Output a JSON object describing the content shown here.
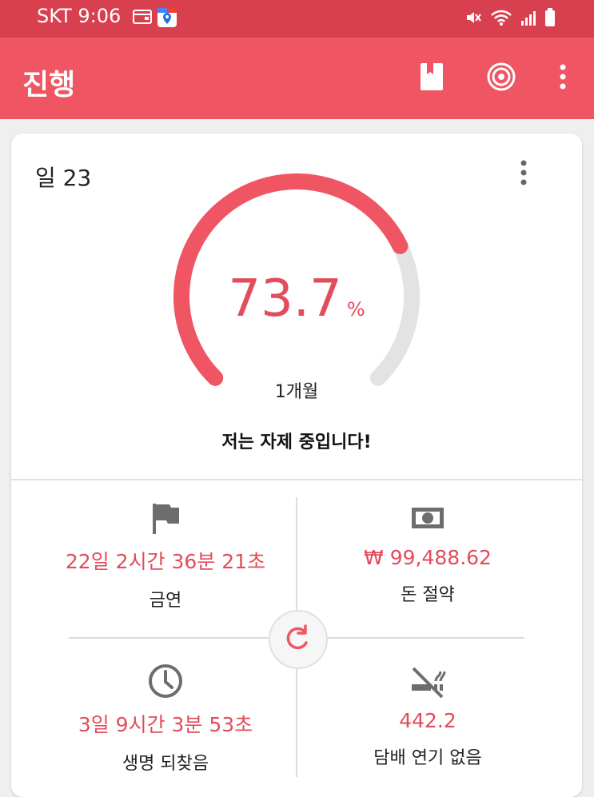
{
  "status_bar": {
    "carrier_time": "SKT 9:06",
    "icons_left": [
      "wallet-icon",
      "maps-app-icon"
    ],
    "icons_right": [
      "mute-icon",
      "wifi-icon",
      "signal-icon",
      "battery-icon"
    ]
  },
  "appbar": {
    "title": "진행",
    "actions": [
      "bookmark-icon",
      "target-icon",
      "more-vert-icon"
    ],
    "color": "#ef5563"
  },
  "progress_card": {
    "day_label": "일 23",
    "percent_value": "73.7",
    "percent_symbol": "%",
    "percent_fraction": 0.737,
    "period_label": "1개월",
    "message": "저는 자제 중입니다!",
    "accent_color": "#e24c5b"
  },
  "stats": {
    "smoke_free": {
      "icon": "flag-icon",
      "value": "22일 2시간 36분 21초",
      "label": "금연"
    },
    "money_saved": {
      "icon": "money-icon",
      "value": "₩ 99,488.62",
      "label": "돈 절약"
    },
    "life_regained": {
      "icon": "clock-icon",
      "value": "3일 9시간 3분 53초",
      "label": "생명 되찾음"
    },
    "cigarettes_not_smoked": {
      "icon": "no-smoking-icon",
      "value": "442.2",
      "label": "담배 연기 없음"
    }
  },
  "reset_button": {
    "icon": "reset-icon"
  }
}
